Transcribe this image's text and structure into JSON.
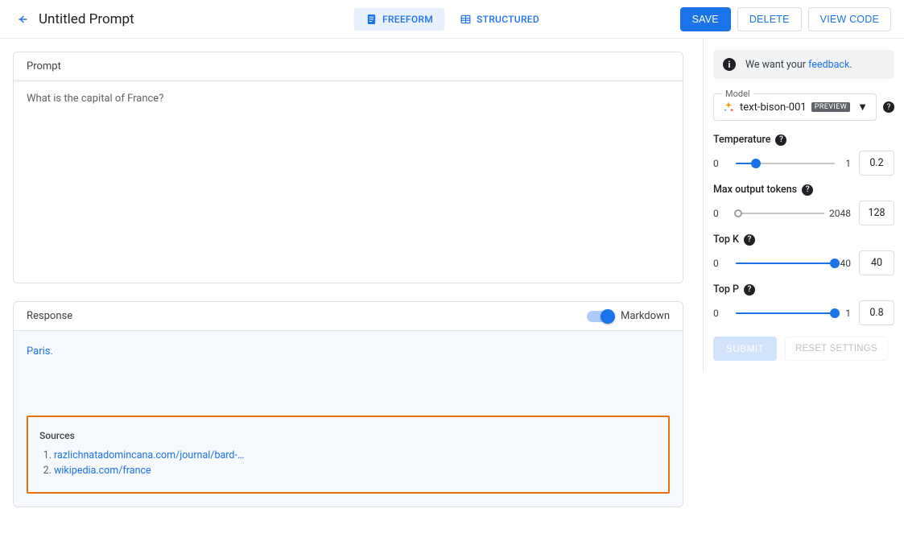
{
  "header": {
    "title": "Untitled Prompt",
    "mode": {
      "freeform": "FREEFORM",
      "structured": "STRUCTURED"
    },
    "actions": {
      "save": "SAVE",
      "delete": "DELETE",
      "view_code": "VIEW CODE"
    }
  },
  "prompt": {
    "heading": "Prompt",
    "text": "What is the capital of France?"
  },
  "response": {
    "heading": "Response",
    "markdown_label": "Markdown",
    "answer": "Paris.",
    "sources_heading": "Sources",
    "sources": [
      "razlichnatadomincana.com/journal/bard-…",
      "wikipedia.com/france"
    ]
  },
  "sidebar": {
    "banner_prefix": "We want your ",
    "banner_link": "feedback",
    "model": {
      "label": "Model",
      "value": "text-bison-001",
      "badge": "PREVIEW"
    },
    "params": {
      "temperature": {
        "label": "Temperature",
        "min": "0",
        "max": "1",
        "value": "0.2",
        "fill": 20
      },
      "max_tokens": {
        "label": "Max output tokens",
        "min": "0",
        "max": "2048",
        "value": "128",
        "fill": 0
      },
      "top_k": {
        "label": "Top K",
        "min": "0",
        "max": "40",
        "value": "40",
        "fill": 100
      },
      "top_p": {
        "label": "Top P",
        "min": "0",
        "max": "1",
        "value": "0.8",
        "fill": 100
      }
    },
    "submit": "SUBMIT",
    "reset": "RESET SETTINGS"
  }
}
